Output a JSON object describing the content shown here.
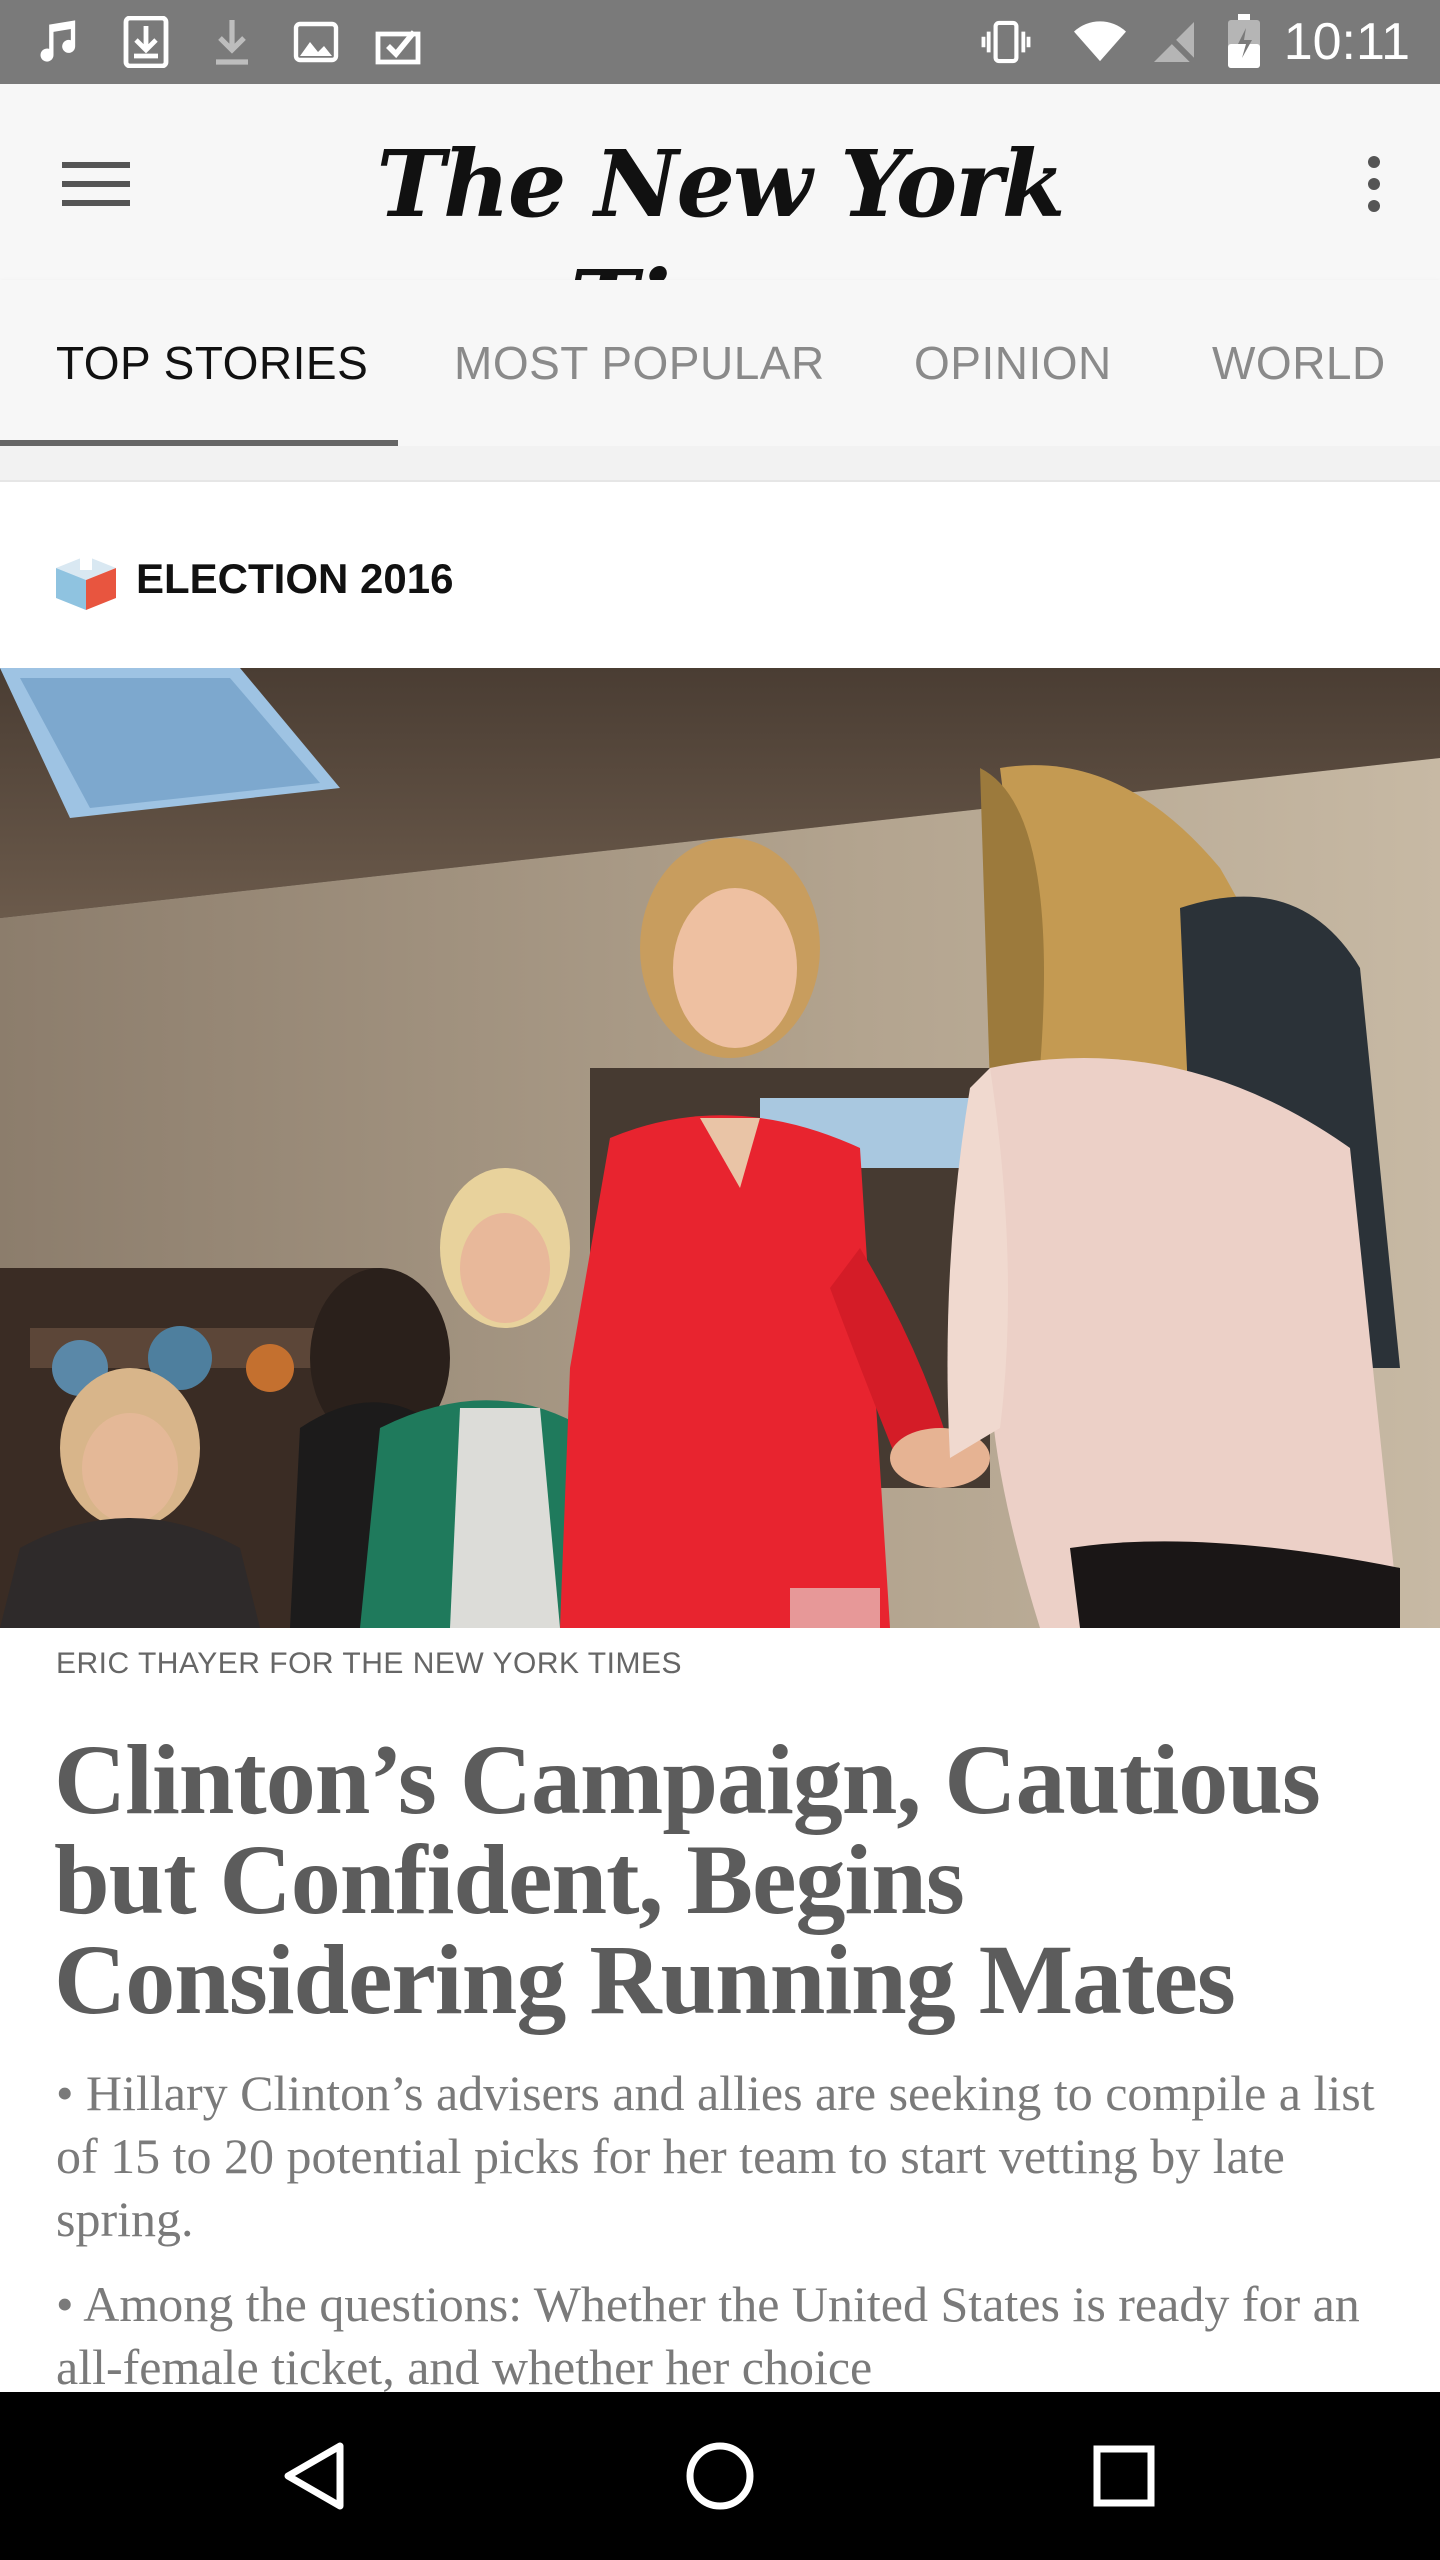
{
  "status_bar": {
    "time": "10:11",
    "left_icons": [
      "music-note-icon",
      "download-box-icon",
      "download-arrow-icon",
      "image-icon",
      "clipboard-check-icon"
    ],
    "right_icons": [
      "vibrate-icon",
      "wifi-icon",
      "no-sim-icon",
      "battery-icon"
    ]
  },
  "app_bar": {
    "title": "The New York Times",
    "menu_icon": "hamburger-menu-icon",
    "more_icon": "more-vert-icon"
  },
  "tabs": [
    {
      "label": "TOP STORIES",
      "active": true
    },
    {
      "label": "MOST POPULAR",
      "active": false
    },
    {
      "label": "OPINION",
      "active": false
    },
    {
      "label": "WORLD",
      "active": false
    }
  ],
  "section": {
    "label": "ELECTION 2016",
    "icon": "ballot-box-icon"
  },
  "article": {
    "photo_credit": "ERIC THAYER FOR THE NEW YORK TIMES",
    "headline": "Clinton’s Campaign, Cautious but Confident, Begins Considering Running Mates",
    "summary": [
      "• Hillary Clinton’s advisers and allies are seeking to compile a list of 15 to 20 potential picks for her team to start vetting by late spring.",
      "• Among the questions: Whether the United States is ready for an all-female ticket, and whether her choice"
    ]
  },
  "nav_bar": {
    "icons": [
      "back-icon",
      "home-icon",
      "recents-icon"
    ]
  },
  "colors": {
    "status_bar": "#7a7a7a",
    "app_bar": "#f7f7f7",
    "headline": "#5c5c5c",
    "summary": "#7a7a7a",
    "nav_bar": "#000000"
  }
}
